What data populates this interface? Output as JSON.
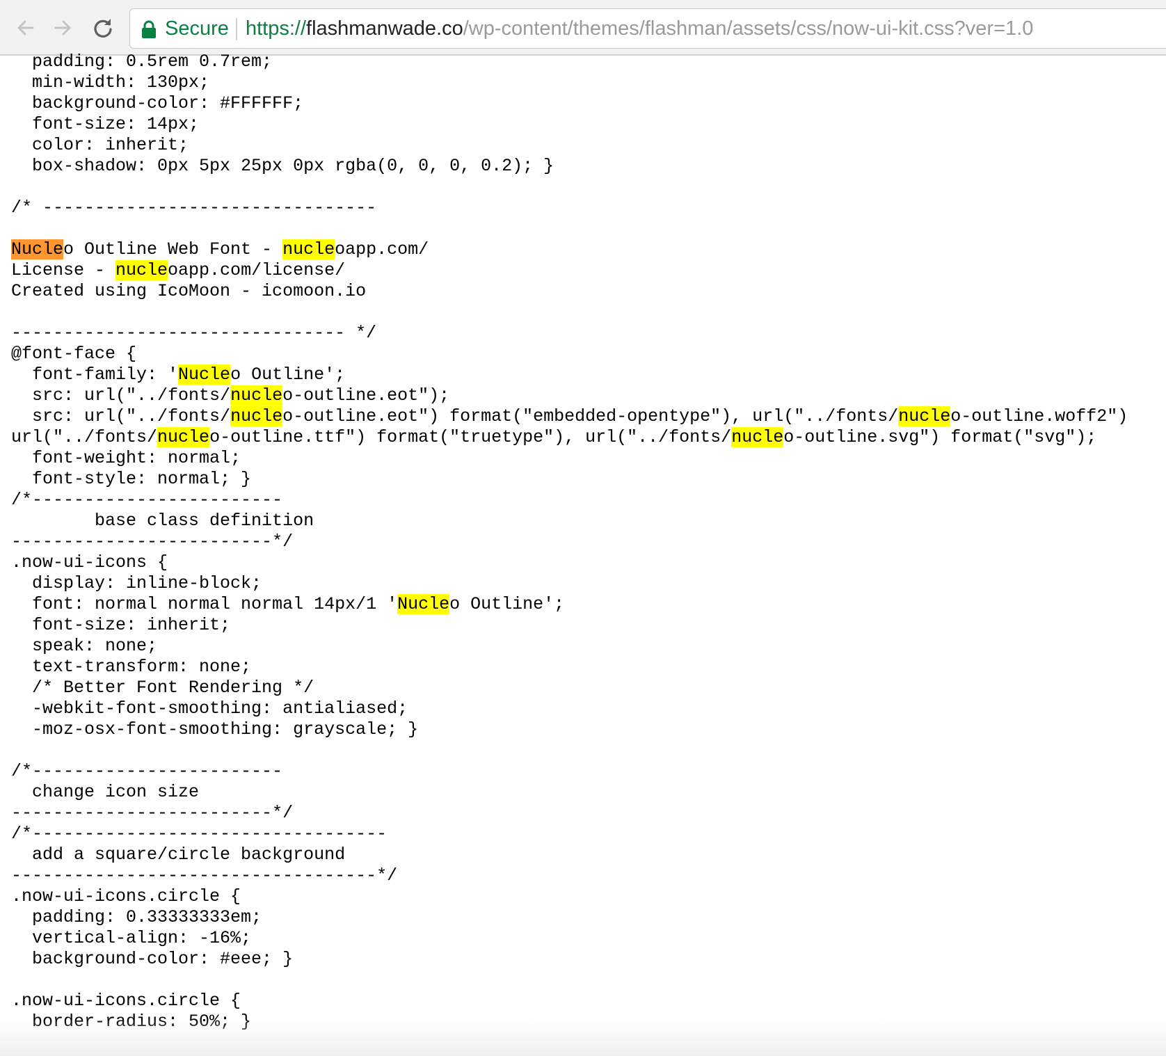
{
  "browser": {
    "secure_label": "Secure",
    "url": {
      "scheme": "https://",
      "host": "flashmanwade.co",
      "path": "/wp-content/themes/flashman/assets/css/now-ui-kit.css?ver=1.0"
    },
    "icons": {
      "back": "arrow-left-icon",
      "forward": "arrow-right-icon",
      "reload": "reload-icon",
      "secure": "lock-icon"
    },
    "colors": {
      "secure_green": "#0b8043",
      "find_highlight": "#ffff00",
      "find_current": "#ff9632"
    }
  },
  "find": {
    "query": "Nucle"
  },
  "code_lines": [
    "  padding: 0.5rem 0.7rem;",
    "  min-width: 130px;",
    "  background-color: #FFFFFF;",
    "  font-size: 14px;",
    "  color: inherit;",
    "  box-shadow: 0px 5px 25px 0px rgba(0, 0, 0, 0.2); }",
    "",
    "/* --------------------------------",
    "",
    "Nucleo Outline Web Font - nucleoapp.com/",
    "License - nucleoapp.com/license/",
    "Created using IcoMoon - icomoon.io",
    "",
    "-------------------------------- */",
    "@font-face {",
    "  font-family: 'Nucleo Outline';",
    "  src: url(\"../fonts/nucleo-outline.eot\");",
    "  src: url(\"../fonts/nucleo-outline.eot\") format(\"embedded-opentype\"), url(\"../fonts/nucleo-outline.woff2\")",
    "url(\"../fonts/nucleo-outline.ttf\") format(\"truetype\"), url(\"../fonts/nucleo-outline.svg\") format(\"svg\");",
    "  font-weight: normal;",
    "  font-style: normal; }",
    "/*------------------------",
    "        base class definition",
    "-------------------------*/",
    ".now-ui-icons {",
    "  display: inline-block;",
    "  font: normal normal normal 14px/1 'Nucleo Outline';",
    "  font-size: inherit;",
    "  speak: none;",
    "  text-transform: none;",
    "  /* Better Font Rendering */",
    "  -webkit-font-smoothing: antialiased;",
    "  -moz-osx-font-smoothing: grayscale; }",
    "",
    "/*------------------------",
    "  change icon size",
    "-------------------------*/",
    "/*----------------------------------",
    "  add a square/circle background",
    "-----------------------------------*/",
    ".now-ui-icons.circle {",
    "  padding: 0.33333333em;",
    "  vertical-align: -16%;",
    "  background-color: #eee; }",
    "",
    ".now-ui-icons.circle {",
    "  border-radius: 50%; }"
  ]
}
